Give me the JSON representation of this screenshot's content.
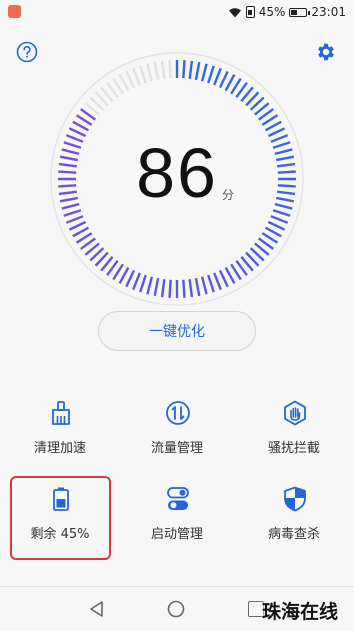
{
  "status_bar": {
    "battery_text": "45%",
    "battery_level": 0.45,
    "time": "23:01"
  },
  "score": {
    "value": "86",
    "unit": "分",
    "level": 0.86
  },
  "optimize_button": {
    "label": "一键优化"
  },
  "tools": [
    {
      "label": "清理加速",
      "icon": "broom-icon"
    },
    {
      "label": "流量管理",
      "icon": "data-traffic-icon"
    },
    {
      "label": "骚扰拦截",
      "icon": "hand-block-icon"
    },
    {
      "label": "剩余 45%",
      "icon": "battery-icon"
    },
    {
      "label": "启动管理",
      "icon": "toggle-icon"
    },
    {
      "label": "病毒查杀",
      "icon": "shield-icon"
    }
  ],
  "watermark": "珠海在线",
  "colors": {
    "accent": "#2466d6",
    "ring_light": "#e3e3e3",
    "highlight": "#d9363e"
  }
}
